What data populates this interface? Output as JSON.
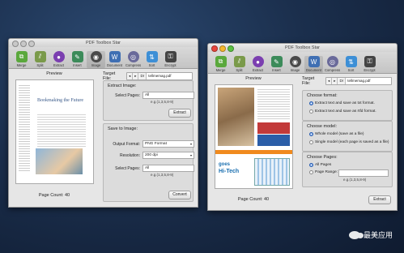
{
  "app_title": "PDF Toolbox Star",
  "toolbar": {
    "items": [
      {
        "label": "Merge",
        "icon": "merge-icon",
        "color": "#5aa83c"
      },
      {
        "label": "Split",
        "icon": "split-icon",
        "color": "#7a9a4a"
      },
      {
        "label": "Extract",
        "icon": "extract-icon",
        "color": "#7b3fb0"
      },
      {
        "label": "Insert",
        "icon": "insert-icon",
        "color": "#3c8b5a"
      },
      {
        "label": "Image",
        "icon": "image-icon",
        "color": "#4a4a4a"
      },
      {
        "label": "Document",
        "icon": "document-icon",
        "color": "#3f6fb3"
      },
      {
        "label": "Compress",
        "icon": "compress-icon",
        "color": "#6a6a9a"
      },
      {
        "label": "Sort",
        "icon": "sort-icon",
        "color": "#3d8fd6"
      },
      {
        "label": "Encrypt",
        "icon": "encrypt-icon",
        "color": "#444444"
      }
    ]
  },
  "left_window": {
    "preview_title": "Preview",
    "page_count": "Page Count: 40",
    "thumb_headline": "Bookmaking the Future",
    "target_label": "Target File:",
    "path": [
      "◂",
      "▸",
      "Dr",
      "tellmemag.pdf"
    ],
    "extract_image": {
      "title": "Extract Image:",
      "select_pages_label": "Select Pages:",
      "select_pages_value": "All",
      "hint": "e.g.(1,3,5,8-9)",
      "button": "Extract"
    },
    "save_to_image": {
      "title": "Save to Image:",
      "output_format_label": "Output Format:",
      "output_format_value": "PNG Format",
      "resolution_label": "Resolution:",
      "resolution_value": "200 dpi",
      "select_pages_label": "Select Pages:",
      "select_pages_value": "All",
      "hint": "e.g.(1,3,5,8-9)",
      "button": "Convert"
    }
  },
  "right_window": {
    "preview_title": "Preview",
    "page_count": "Page Count: 40",
    "target_label": "Target File:",
    "path": [
      "◂",
      "▸",
      "Dr",
      "tellmemag.pdf"
    ],
    "format": {
      "title": "Choose format:",
      "opt1": "Extract text and save as txt format.",
      "opt2": "Extract text and save as rtfd format."
    },
    "model": {
      "title": "Choose model:",
      "opt1": "Whole model (save as a file)",
      "opt2": "Single model (each page is saved as a file)"
    },
    "pages": {
      "title": "Choose Pages:",
      "opt1": "All Pages",
      "opt2": "Page Range:",
      "hint": "e.g.(1,3,5,8-9)"
    },
    "button": "Extract",
    "thumb_text": "Hi-Tech",
    "thumb_sub": "goes"
  },
  "watermark": "最美应用"
}
